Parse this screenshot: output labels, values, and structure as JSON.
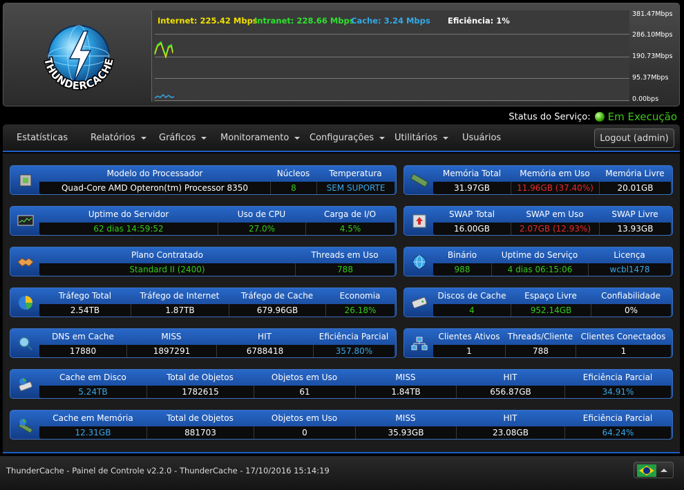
{
  "logo": {
    "text": "THUNDERCACHE"
  },
  "graph": {
    "legend": {
      "internet": "Internet: 225.42 Mbps",
      "intranet": "Intranet: 228.66 Mbps",
      "cache": "Cache: 3.24 Mbps",
      "efficiency": "Eficiência: 1%"
    },
    "y_ticks": [
      "381.47Mbps",
      "286.10Mbps",
      "190.73Mbps",
      "95.37Mbps",
      "0.00bps"
    ],
    "colors": {
      "internet": "#f0e000",
      "intranet": "#2ee02e",
      "cache": "#33a9e6"
    }
  },
  "status": {
    "label": "Status do Serviço:",
    "value": "Em Execução"
  },
  "nav": {
    "items": [
      {
        "label": "Estatísticas",
        "dropdown": false
      },
      {
        "label": "Relatórios",
        "dropdown": true
      },
      {
        "label": "Gráficos",
        "dropdown": true
      },
      {
        "label": "Monitoramento",
        "dropdown": true
      },
      {
        "label": "Configurações",
        "dropdown": true
      },
      {
        "label": "Utilitários",
        "dropdown": true
      },
      {
        "label": "Usuários",
        "dropdown": false
      }
    ],
    "logout": "Logout (admin)"
  },
  "panels": {
    "cpu": {
      "icon": "cpu-chip-icon",
      "headers": [
        "Modelo do Processador",
        "Núcleos",
        "Temperatura"
      ],
      "values": [
        "Quad-Core AMD Opteron(tm) Processor 8350",
        "8",
        "SEM SUPORTE"
      ]
    },
    "memory": {
      "icon": "memory-module-icon",
      "headers": [
        "Memória Total",
        "Memória em Uso",
        "Memória Livre"
      ],
      "values": [
        "31.97GB",
        "11.96GB (37.40%)",
        "20.01GB"
      ]
    },
    "uptime": {
      "icon": "monitor-icon",
      "headers": [
        "Uptime do Servidor",
        "Uso de CPU",
        "Carga de I/O"
      ],
      "values": [
        "62 dias 14:59:52",
        "27.0%",
        "4.5%"
      ]
    },
    "swap": {
      "icon": "swap-icon",
      "headers": [
        "SWAP Total",
        "SWAP em Uso",
        "SWAP Livre"
      ],
      "values": [
        "16.00GB",
        "2.07GB (12.93%)",
        "13.93GB"
      ]
    },
    "plan": {
      "icon": "handshake-icon",
      "headers": [
        "Plano Contratado",
        "Threads em Uso"
      ],
      "values": [
        "Standard II (2400)",
        "788"
      ]
    },
    "binary": {
      "icon": "globe-icon",
      "headers": [
        "Binário",
        "Uptime do Serviço",
        "Licença"
      ],
      "values": [
        "988",
        "4 dias 06:15:06",
        "wcbl1478"
      ]
    },
    "traffic": {
      "icon": "pie-chart-icon",
      "headers": [
        "Tráfego Total",
        "Tráfego de Internet",
        "Tráfego de Cache",
        "Economia"
      ],
      "values": [
        "2.54TB",
        "1.87TB",
        "679.96GB",
        "26.18%"
      ]
    },
    "disks": {
      "icon": "hard-disk-icon",
      "headers": [
        "Discos de Cache",
        "Espaço Livre",
        "Confiabilidade"
      ],
      "values": [
        "4",
        "952.14GB",
        "0%"
      ]
    },
    "dns": {
      "icon": "dns-search-icon",
      "headers": [
        "DNS em Cache",
        "MISS",
        "HIT",
        "Eficiência Parcial"
      ],
      "values": [
        "17880",
        "1897291",
        "6788418",
        "357.80%"
      ]
    },
    "clients": {
      "icon": "network-icon",
      "headers": [
        "Clientes Ativos",
        "Threads/Cliente",
        "Clientes Conectados"
      ],
      "values": [
        "1",
        "788",
        "1"
      ]
    },
    "disk_cache": {
      "icon": "disk-chart-icon",
      "headers": [
        "Cache em Disco",
        "Total de Objetos",
        "Objetos em Uso",
        "MISS",
        "HIT",
        "Eficiência Parcial"
      ],
      "values": [
        "5.24TB",
        "1782615",
        "61",
        "1.84TB",
        "656.87GB",
        "34.91%"
      ]
    },
    "mem_cache": {
      "icon": "memory-chart-icon",
      "headers": [
        "Cache em Memória",
        "Total de Objetos",
        "Objetos em Uso",
        "MISS",
        "HIT",
        "Eficiência Parcial"
      ],
      "values": [
        "12.31GB",
        "881703",
        "0",
        "35.93GB",
        "23.08GB",
        "64.24%"
      ]
    }
  },
  "footer": {
    "text": "ThunderCache - Painel de Controle v2.2.0 - ThunderCache - 17/10/2016 15:14:19"
  }
}
